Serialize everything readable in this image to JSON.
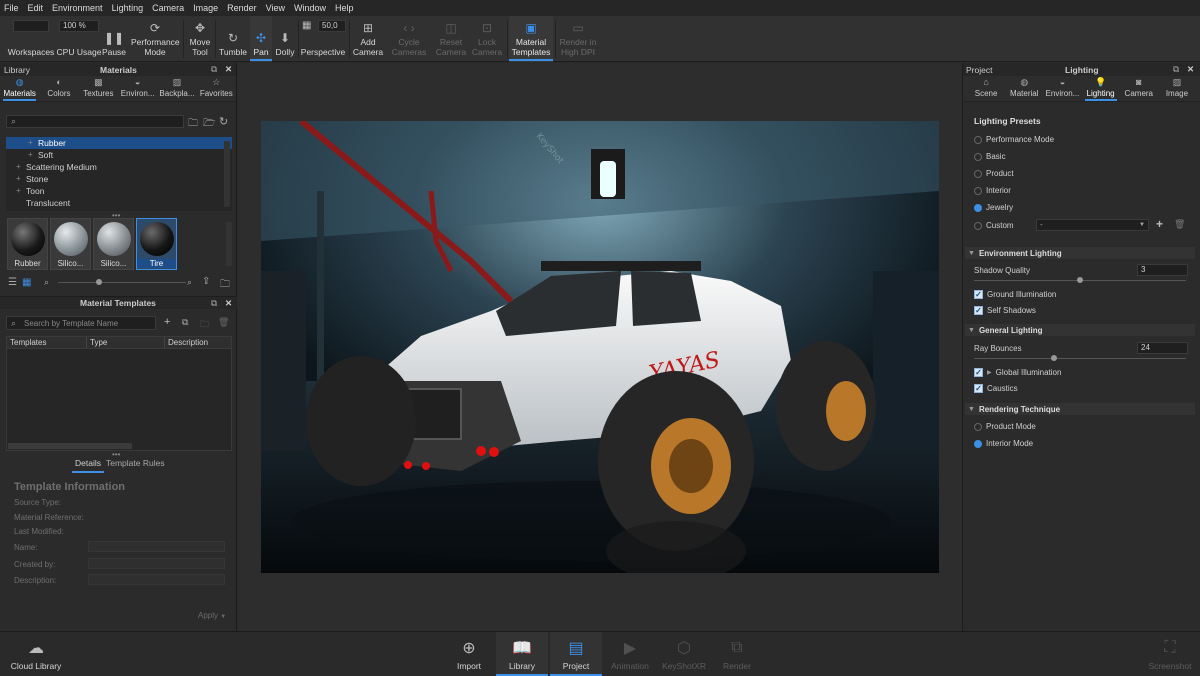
{
  "menu": [
    "File",
    "Edit",
    "Environment",
    "Lighting",
    "Camera",
    "Image",
    "Render",
    "View",
    "Window",
    "Help"
  ],
  "toolbar": {
    "cpu_value": "100 %",
    "workspaces": "Workspaces",
    "cpu_usage": "CPU Usage",
    "pause": "Pause",
    "performance_mode": "Performance Mode",
    "move_tool": "Move Tool",
    "tumble": "Tumble",
    "pan": "Pan",
    "dolly": "Dolly",
    "fov_value": "50,0",
    "perspective": "Perspective",
    "add_camera": "Add Camera",
    "cycle_cameras": "Cycle Cameras",
    "reset_camera": "Reset Camera",
    "lock_camera": "Lock Camera",
    "material_templates": "Material Templates",
    "render_high_dpi": "Render in High DPI"
  },
  "library": {
    "panel_label": "Library",
    "title": "Materials",
    "tabs": [
      "Materials",
      "Colors",
      "Textures",
      "Environ...",
      "Backpla...",
      "Favorites"
    ],
    "tree": [
      {
        "label": "Rubber",
        "selected": true,
        "indent": true
      },
      {
        "label": "Soft",
        "selected": false,
        "indent": true
      },
      {
        "label": "Scattering Medium",
        "selected": false,
        "indent": false
      },
      {
        "label": "Stone",
        "selected": false,
        "indent": false
      },
      {
        "label": "Toon",
        "selected": false,
        "indent": false
      },
      {
        "label": "Translucent",
        "selected": false,
        "indent": false
      }
    ],
    "thumbnails": [
      "Rubber",
      "Silico...",
      "Silico...",
      "Tire"
    ]
  },
  "material_templates": {
    "title": "Material Templates",
    "search_placeholder": "Search by Template Name",
    "columns": [
      "Templates",
      "Type",
      "Description"
    ],
    "subtabs": [
      "Details",
      "Template Rules"
    ],
    "info_title": "Template Information",
    "fields": [
      "Source Type:",
      "Material Reference:",
      "Last Modified:",
      "Name:",
      "Created by:",
      "Description:"
    ],
    "apply": "Apply"
  },
  "project": {
    "panel_label": "Project",
    "title": "Lighting",
    "tabs": [
      "Scene",
      "Material",
      "Environ...",
      "Lighting",
      "Camera",
      "Image"
    ],
    "presets_title": "Lighting Presets",
    "presets": [
      "Performance Mode",
      "Basic",
      "Product",
      "Interior",
      "Jewelry",
      "Custom"
    ],
    "selected_preset": "Jewelry",
    "custom_value": "-",
    "env_section": "Environment Lighting",
    "shadow_quality_label": "Shadow Quality",
    "shadow_quality_value": "3",
    "ground_illumination": "Ground Illumination",
    "self_shadows": "Self Shadows",
    "general_section": "General Lighting",
    "ray_bounces_label": "Ray Bounces",
    "ray_bounces_value": "24",
    "global_illumination": "Global Illumination",
    "caustics": "Caustics",
    "technique_section": "Rendering Technique",
    "techniques": [
      "Product Mode",
      "Interior Mode"
    ],
    "selected_technique": "Interior Mode"
  },
  "viewport": {
    "truck_text": "YAYAS",
    "watermark": "KeyShot"
  },
  "bottom": {
    "cloud_library": "Cloud Library",
    "import": "Import",
    "library": "Library",
    "project": "Project",
    "animation": "Animation",
    "keyshotxr": "KeyShotXR",
    "render": "Render",
    "screenshot": "Screenshot"
  },
  "colors": {
    "accent": "#3d8fe6",
    "panel": "#2b2b2b",
    "selection": "#1d4e8a"
  }
}
